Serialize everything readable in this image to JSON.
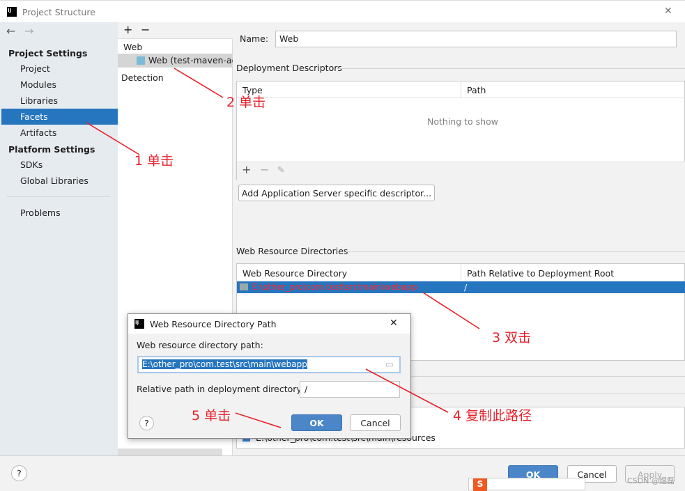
{
  "window": {
    "title": "Project Structure",
    "close": "✕"
  },
  "nav": {
    "back": "←",
    "forward": "→"
  },
  "sidebar": {
    "project_settings": "Project Settings",
    "items1": [
      "Project",
      "Modules",
      "Libraries",
      "Facets",
      "Artifacts"
    ],
    "platform_settings": "Platform Settings",
    "items2": [
      "SDKs",
      "Global Libraries"
    ],
    "problems": "Problems"
  },
  "facets": {
    "add": "+",
    "remove": "−",
    "group": "Web",
    "item": "Web (test-maven-ao",
    "detection": "Detection"
  },
  "form": {
    "name_label": "Name:",
    "name_value": "Web",
    "dd_title": "Deployment Descriptors",
    "dd_cols": [
      "Type",
      "Path"
    ],
    "dd_empty": "Nothing to show",
    "add_descriptor": "Add Application Server specific descriptor...",
    "wr_title": "Web Resource Directories",
    "wr_cols": [
      "Web Resource Directory",
      "Path Relative to Deployment Root"
    ],
    "wr_row": {
      "dir": "E:\\other_pro\\com.test\\src\\main\\webapp",
      "path": "/"
    },
    "source_root": "E:\\other_pro\\com.test\\src\\main\\resources"
  },
  "dialog": {
    "title": "Web Resource Directory Path",
    "path_label": "Web resource directory path:",
    "path_value": "E:\\other_pro\\com.test\\src\\main\\webapp",
    "rel_label": "Relative path in deployment directory:",
    "rel_value": "/",
    "ok": "OK",
    "cancel": "Cancel",
    "help": "?"
  },
  "footer": {
    "help": "?",
    "ok": "OK",
    "cancel": "Cancel",
    "apply": "Apply",
    "watermark": "CSDN @煜磊"
  },
  "annotations": [
    "1 单击",
    "2 单击",
    "3 双击",
    "4 复制此路径",
    "5 单击"
  ],
  "colors": {
    "selection": "#2675bf",
    "annotation": "#e8202a"
  }
}
